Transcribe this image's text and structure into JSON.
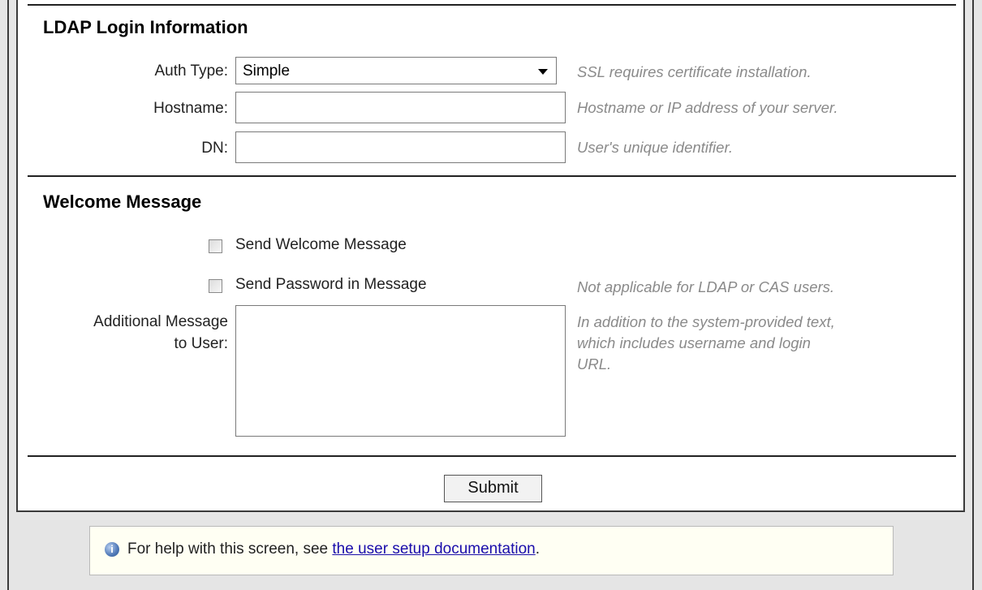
{
  "ldap_section": {
    "title": "LDAP Login Information",
    "auth_type_label": "Auth Type:",
    "auth_type_value": "Simple",
    "auth_type_hint": "SSL requires certificate installation.",
    "hostname_label": "Hostname:",
    "hostname_value": "",
    "hostname_hint": "Hostname or IP address of your server.",
    "dn_label": "DN:",
    "dn_value": "",
    "dn_hint": "User's unique identifier."
  },
  "welcome_section": {
    "title": "Welcome Message",
    "send_welcome_label": "Send Welcome Message",
    "send_welcome_checked": false,
    "send_password_label": "Send Password in Message",
    "send_password_checked": false,
    "send_password_hint": "Not applicable for LDAP or CAS users.",
    "additional_label_line1": "Additional Message",
    "additional_label_line2": "to User:",
    "additional_value": "",
    "additional_hint_line1": "In addition to the system-provided text,",
    "additional_hint_line2": "which includes username and login",
    "additional_hint_line3": "URL."
  },
  "submit_label": "Submit",
  "help": {
    "prefix": "For help with this screen, see ",
    "link_text": "the user setup documentation",
    "suffix": "."
  },
  "icons": {
    "help": "help-info-icon",
    "dropdown": "chevron-down-icon"
  },
  "colors": {
    "hint": "#8a8a8a",
    "link": "#1a0dab",
    "help_box_bg": "#fffff3"
  }
}
